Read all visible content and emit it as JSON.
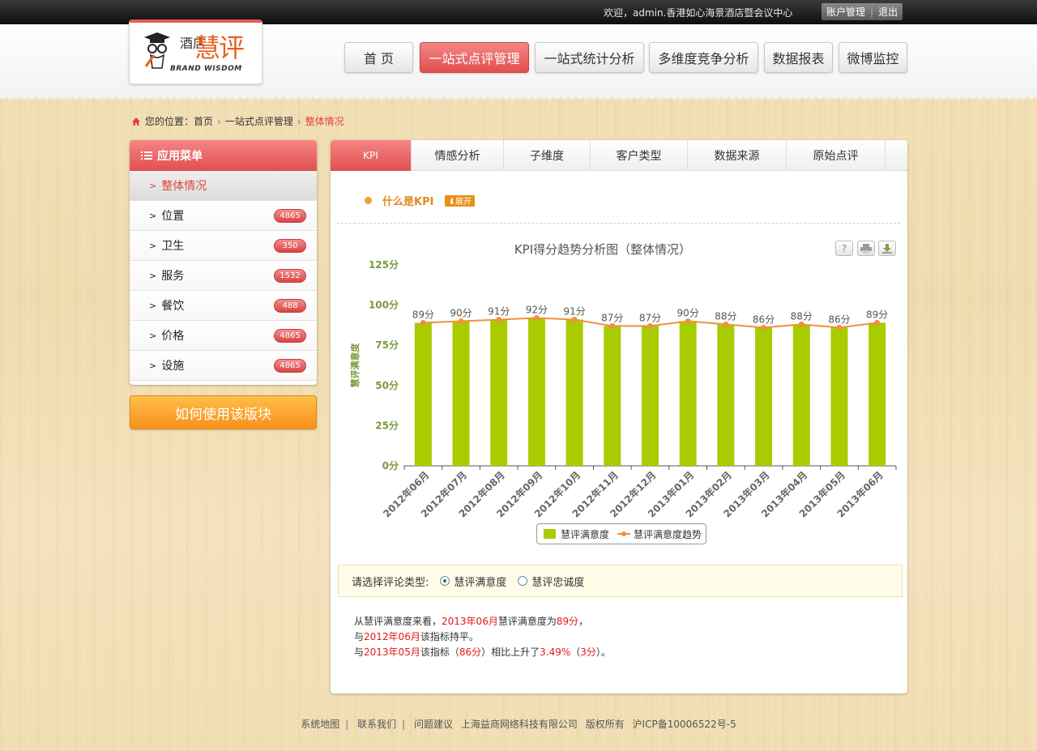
{
  "topbar": {
    "welcome": "欢迎，admin.香港如心海景酒店暨会议中心",
    "account_label": "账户管理",
    "logout_label": "退出"
  },
  "logo": {
    "line1": "酒店",
    "big": "慧评",
    "en": "BRAND WISDOM"
  },
  "nav": [
    {
      "label": "首 页"
    },
    {
      "label": "一站式点评管理"
    },
    {
      "label": "一站式统计分析"
    },
    {
      "label": "多维度竞争分析"
    },
    {
      "label": "数据报表"
    },
    {
      "label": "微博监控"
    }
  ],
  "breadcrumb": {
    "prefix": "您的位置：",
    "home": "首页",
    "section": "一站式点评管理",
    "current": "整体情况"
  },
  "sidebar": {
    "title": "应用菜单",
    "items": [
      {
        "label": "整体情况",
        "badge": ""
      },
      {
        "label": "位置",
        "badge": "4865"
      },
      {
        "label": "卫生",
        "badge": "350"
      },
      {
        "label": "服务",
        "badge": "1532"
      },
      {
        "label": "餐饮",
        "badge": "488"
      },
      {
        "label": "价格",
        "badge": "4865"
      },
      {
        "label": "设施",
        "badge": "4865"
      }
    ],
    "howto": "如何使用该版块"
  },
  "tabs": [
    {
      "label": "KPI"
    },
    {
      "label": "情感分析"
    },
    {
      "label": "子维度"
    },
    {
      "label": "客户类型"
    },
    {
      "label": "数据来源"
    },
    {
      "label": "原始点评"
    }
  ],
  "kpi_info": {
    "label": "什么是KPI",
    "expand": "⬇展开"
  },
  "chart_data": {
    "type": "bar",
    "title": "KPI得分趋势分析图（整体情况）",
    "ylabel": "慧评满意度",
    "ylim": [
      0,
      125
    ],
    "yticks": [
      "0分",
      "25分",
      "50分",
      "75分",
      "100分",
      "125分"
    ],
    "categories": [
      "2012年06月",
      "2012年07月",
      "2012年08月",
      "2012年09月",
      "2012年10月",
      "2012年11月",
      "2012年12月",
      "2013年01月",
      "2013年02月",
      "2013年03月",
      "2013年04月",
      "2013年05月",
      "2013年06月"
    ],
    "series": [
      {
        "name": "慧评满意度",
        "kind": "bar",
        "color": "#a9cc00",
        "values": [
          89,
          90,
          91,
          92,
          91,
          87,
          87,
          90,
          88,
          86,
          88,
          86,
          89
        ]
      },
      {
        "name": "慧评满意度趋势",
        "kind": "line",
        "color": "#f09040",
        "values": [
          89,
          90,
          91,
          92,
          91,
          87,
          87,
          90,
          88,
          86,
          88,
          86,
          89
        ]
      }
    ],
    "value_suffix": "分",
    "legend": "bottom"
  },
  "review_type": {
    "prompt": "请选择评论类型:",
    "options": [
      {
        "label": "慧评满意度",
        "checked": true
      },
      {
        "label": "慧评忠诚度",
        "checked": false
      }
    ]
  },
  "summary": {
    "l1a": "从慧评满意度来看，",
    "l1b": "2013年06月",
    "l1c": "慧评满意度为",
    "l1d": "89分",
    "l1e": "，",
    "l2a": "与",
    "l2b": "2012年06月",
    "l2c": "该指标持平。",
    "l3a": "与",
    "l3b": "2013年05月",
    "l3c": "该指标（",
    "l3d": "86分",
    "l3e": "）相比上升了",
    "l3f": "3.49%",
    "l3g": "（",
    "l3h": "3分",
    "l3i": "）。"
  },
  "footer": {
    "links": [
      "系统地图",
      "联系我们",
      "问题建议"
    ],
    "company": "上海益商网络科技有限公司",
    "rights": "版权所有",
    "icp": "沪ICP备10006522号-5"
  },
  "colors": {
    "accent_red": "#e14f4f",
    "accent_orange": "#f7901a",
    "bar_green": "#a9cc00",
    "line_orange": "#f09040",
    "axis_green": "#7a9a3a"
  }
}
